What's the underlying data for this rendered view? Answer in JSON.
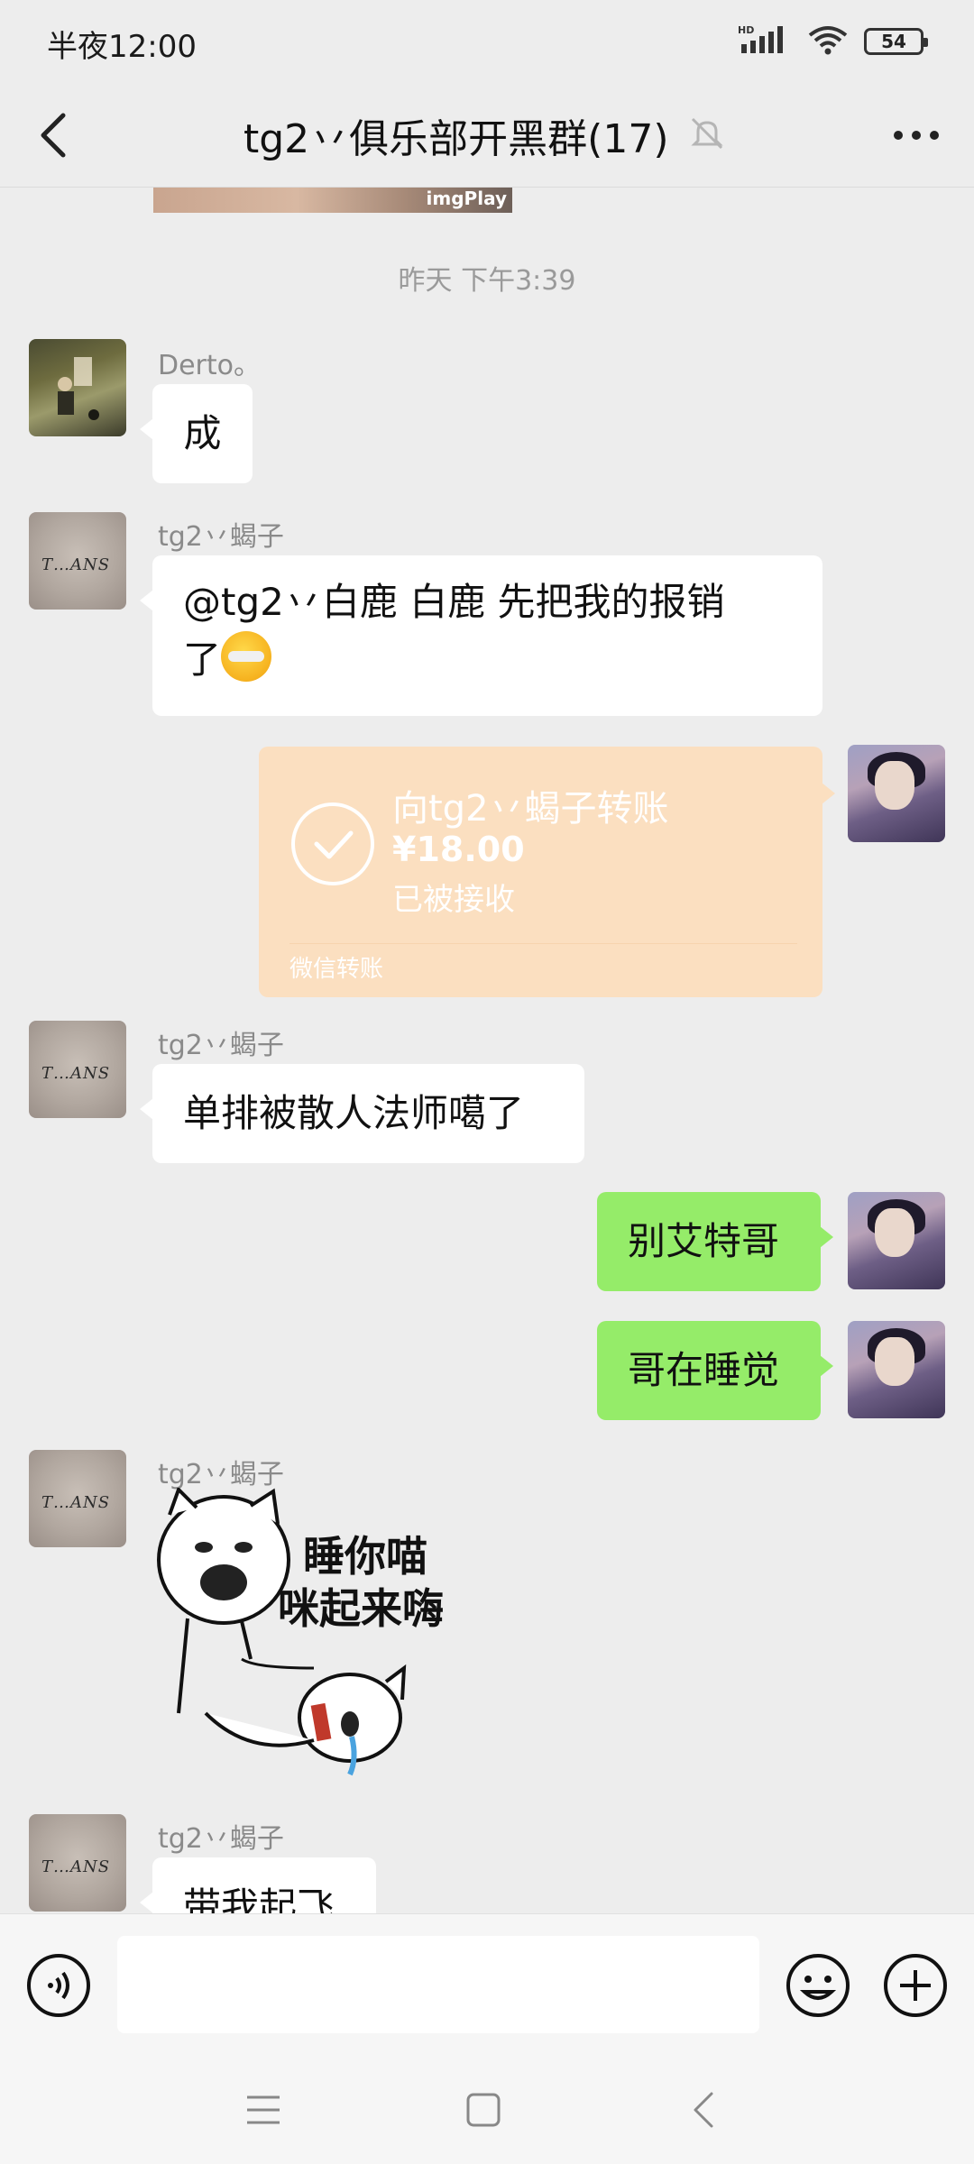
{
  "status_bar": {
    "time": "半夜12:00",
    "network_label": "HD",
    "battery": "54"
  },
  "header": {
    "title": "tg2丷俱乐部开黑群(17)"
  },
  "image_sliver": {
    "watermark": "imgPlay"
  },
  "chat": {
    "timestamp": "昨天 下午3:39",
    "messages": [
      {
        "sender": "Derto。",
        "text": "成"
      },
      {
        "sender": "tg2丷蝎子",
        "text_line1": "@tg2丷白鹿  白鹿  先把我的报销",
        "text_line2": "了"
      },
      {
        "transfer": {
          "title": "向tg2丷蝎子转账",
          "amount": "¥18.00",
          "status": "已被接收",
          "footer": "微信转账"
        }
      },
      {
        "sender": "tg2丷蝎子",
        "text": "单排被散人法师噶了"
      },
      {
        "text": "别艾特哥"
      },
      {
        "text": "哥在睡觉"
      },
      {
        "sender": "tg2丷蝎子",
        "sticker_text_line1": "睡你喵",
        "sticker_text_line2": "咪起来嗨"
      },
      {
        "sender": "tg2丷蝎子",
        "text": "带我起飞"
      }
    ]
  },
  "avatars": {
    "xiezi_signature": "T…ANS"
  },
  "input_bar": {
    "placeholder": ""
  },
  "colors": {
    "background": "#ededed",
    "my_bubble": "#95ec69",
    "transfer_card": "#fbdfc0"
  }
}
